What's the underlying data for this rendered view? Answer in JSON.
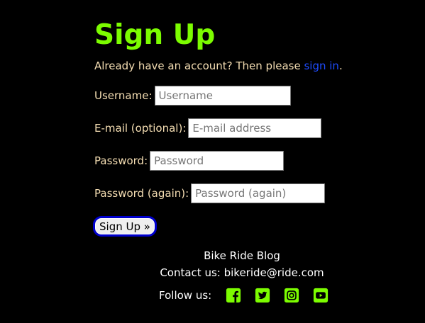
{
  "page": {
    "title": "Sign Up",
    "signin_prefix": "Already have an account? Then please ",
    "signin_link": "sign in",
    "signin_suffix": "."
  },
  "form": {
    "username": {
      "label": "Username:",
      "placeholder": "Username"
    },
    "email": {
      "label": "E-mail (optional):",
      "placeholder": "E-mail address"
    },
    "password": {
      "label": "Password:",
      "placeholder": "Password"
    },
    "password_again": {
      "label": "Password (again):",
      "placeholder": "Password (again)"
    },
    "submit_label": "Sign Up »"
  },
  "footer": {
    "site_name": "Bike Ride Blog",
    "contact": "Contact us: bikeride@ride.com",
    "follow_label": "Follow us:",
    "social_icons": [
      "facebook-icon",
      "twitter-icon",
      "instagram-icon",
      "youtube-icon"
    ]
  },
  "colors": {
    "background": "#000000",
    "title": "#7CFC00",
    "label": "#F5DEB3",
    "link": "#1E4CFF",
    "icons": "#7CFC00",
    "button_border": "#0000CD"
  }
}
